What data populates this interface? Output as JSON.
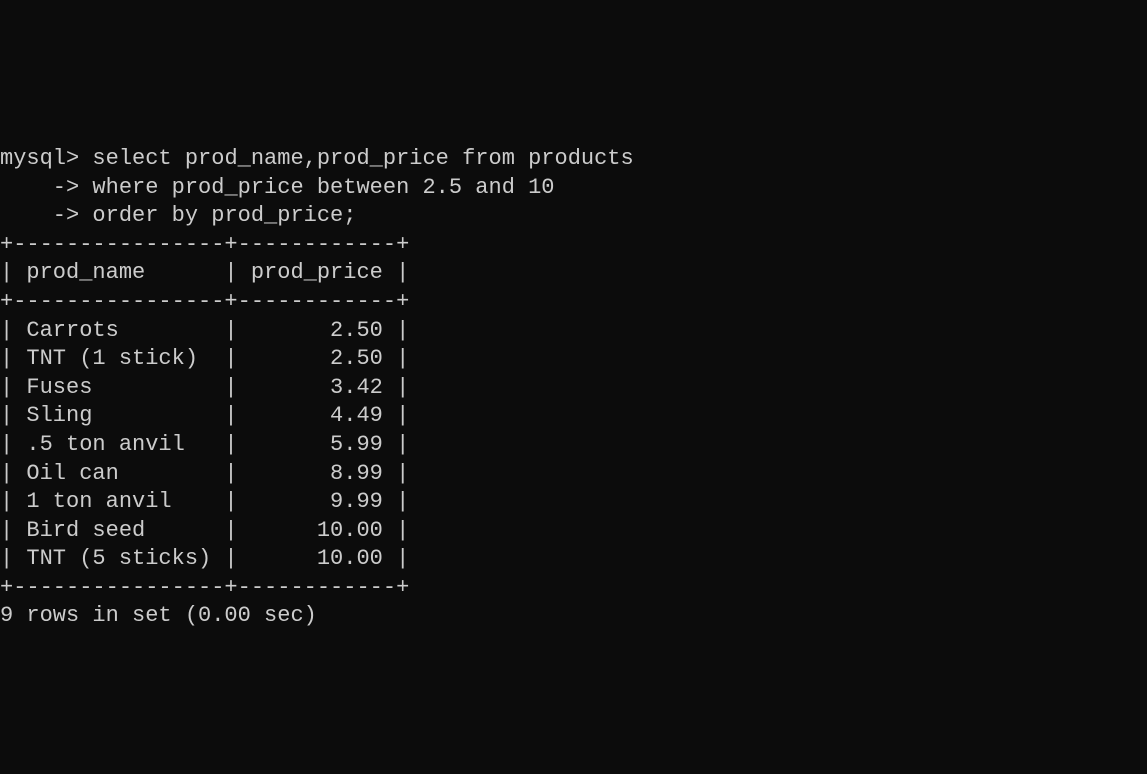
{
  "chart_data": {
    "type": "table",
    "title": "",
    "columns": [
      "prod_name",
      "prod_price"
    ],
    "rows": [
      {
        "prod_name": "Carrots",
        "prod_price": 2.5
      },
      {
        "prod_name": "TNT (1 stick)",
        "prod_price": 2.5
      },
      {
        "prod_name": "Fuses",
        "prod_price": 3.42
      },
      {
        "prod_name": "Sling",
        "prod_price": 4.49
      },
      {
        "prod_name": ".5 ton anvil",
        "prod_price": 5.99
      },
      {
        "prod_name": "Oil can",
        "prod_price": 8.99
      },
      {
        "prod_name": "1 ton anvil",
        "prod_price": 9.99
      },
      {
        "prod_name": "Bird seed",
        "prod_price": 10.0
      },
      {
        "prod_name": "TNT (5 sticks)",
        "prod_price": 10.0
      }
    ]
  },
  "prompt_main": "mysql>",
  "prompt_cont": "    ->",
  "query_line1": " select prod_name,prod_price from products",
  "query_line2": " where prod_price between 2.5 and 10",
  "query_line3": " order by prod_price;",
  "divider": "+----------------+------------+",
  "header_row": "| prod_name      | prod_price |",
  "col1_width": 14,
  "col2_width": 10,
  "summary": "9 rows in set (0.00 sec)"
}
